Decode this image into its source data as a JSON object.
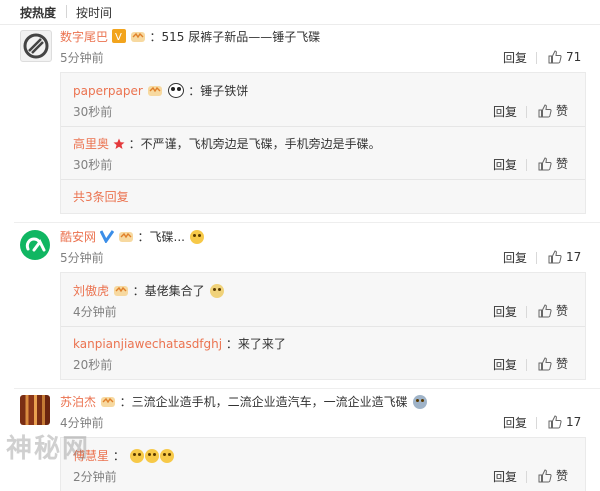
{
  "tabs": {
    "hot": "按热度",
    "time": "按时间"
  },
  "comments": [
    {
      "name": "数字尾巴",
      "text": "：515 尿裤子新品——锤子飞碟",
      "time": "5分钟前",
      "reply": "回复",
      "likes": "71",
      "subs": [
        {
          "name": "paperpaper",
          "text": "：锤子铁饼",
          "time": "30秒前",
          "reply": "回复",
          "like": "赞"
        },
        {
          "name": "高里奥",
          "text": "：不严谨，飞机旁边是飞碟，手机旁边是手碟。",
          "time": "30秒前",
          "reply": "回复",
          "like": "赞"
        }
      ],
      "more": "共3条回复"
    },
    {
      "name": "酷安网",
      "text": "：飞碟...",
      "time": "5分钟前",
      "reply": "回复",
      "likes": "17",
      "subs": [
        {
          "name": "刘傲虎",
          "text": "：基佬集合了",
          "time": "4分钟前",
          "reply": "回复",
          "like": "赞"
        },
        {
          "name": "kanpianjiawechatasdfghj",
          "text": "：来了来了",
          "time": "20秒前",
          "reply": "回复",
          "like": "赞"
        }
      ]
    },
    {
      "name": "苏泊杰",
      "text": "：三流企业造手机，二流企业造汽车，一流企业造飞碟",
      "time": "4分钟前",
      "reply": "回复",
      "likes": "17"
    },
    {
      "name": "傅慧星",
      "text": "：",
      "time": "2分钟前",
      "reply": "回复",
      "like": "赞"
    }
  ],
  "watermark": "神秘网",
  "colors": {
    "name": "#eb7350",
    "time": "#808080",
    "bg_sub": "#f7f7f7"
  },
  "icons": [
    "vip-badge-icon",
    "verified-v-icon",
    "crown-level-icon",
    "star-icon",
    "laugh-emoji-icon",
    "panda-emoji-icon",
    "thumb-up-icon"
  ]
}
